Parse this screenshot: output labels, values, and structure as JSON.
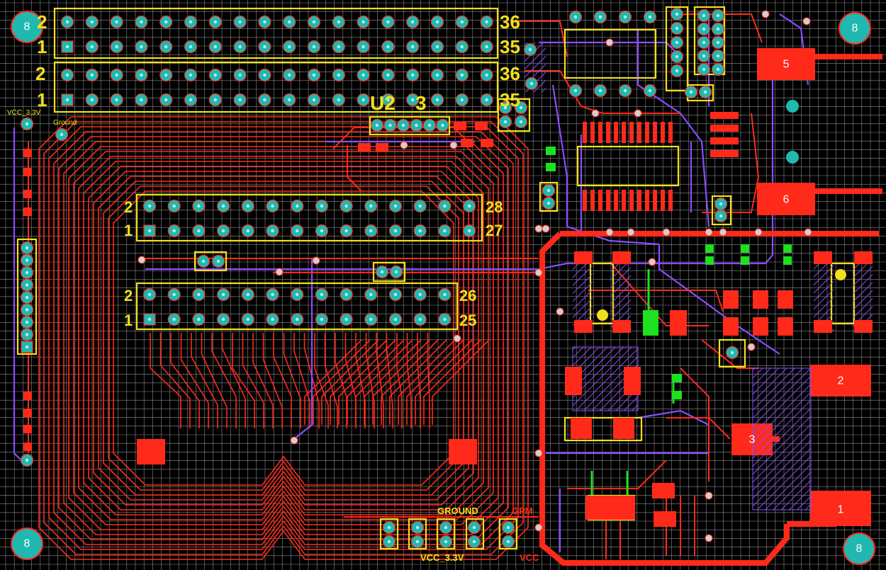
{
  "board": {
    "background": "#000000",
    "grid_color": "#9a9a9a",
    "copper_top": "#ff2a1a",
    "copper_bottom": "#8a4dff",
    "silkscreen": "#f2e01a",
    "pad_fill": "#20b8b0",
    "via_fill": "#cfcfcf"
  },
  "labels": {
    "header_top_pin2": "2",
    "header_top_pin1": "1",
    "header_top_pin36a": "36",
    "header_top_pin35a": "35",
    "header_mid_pin2": "2",
    "header_mid_pin1": "1",
    "header_mid_pin36": "36",
    "header_mid_pin35": "35",
    "u2_label": "U2",
    "u3_label": "3",
    "header28_pin2": "2",
    "header28_pin1": "1",
    "header28_pin28": "28",
    "header28_pin27": "27",
    "header26_pin2": "2",
    "header26_pin1": "1",
    "header26_pin26": "26",
    "header26_pin25": "25",
    "vcc33_left": "VCC_3.3V",
    "ground_left": "Ground",
    "ground_bottom": "GROUND",
    "gpm_bottom": "GPM",
    "vcc33_bottom": "VCC_3.3V",
    "vcc_bottom": "VCC",
    "mount_tl": "8",
    "mount_tr": "8",
    "mount_bl": "8",
    "mount_br": "8",
    "pad1": "1",
    "pad2": "2",
    "pad3": "3",
    "pad5": "5",
    "pad6": "6"
  }
}
